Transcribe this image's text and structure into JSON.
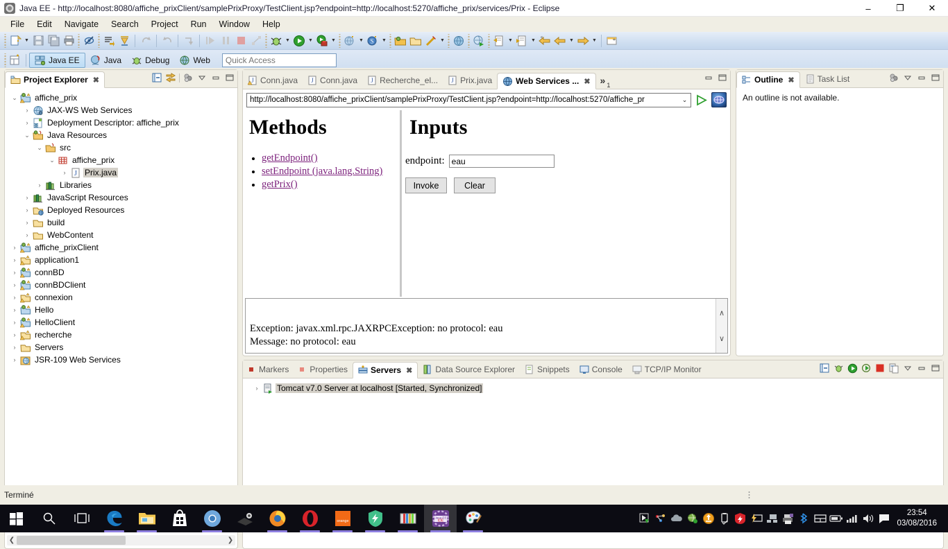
{
  "window": {
    "title": "Java EE - http://localhost:8080/affiche_prixClient/samplePrixProxy/TestClient.jsp?endpoint=http://localhost:5270/affiche_prix/services/Prix - Eclipse",
    "minimize": "–",
    "maximize": "❐",
    "close": "✕"
  },
  "menu": {
    "items": [
      "File",
      "Edit",
      "Navigate",
      "Search",
      "Project",
      "Run",
      "Window",
      "Help"
    ]
  },
  "perspectives": {
    "items": [
      {
        "label": "Java EE",
        "active": true
      },
      {
        "label": "Java",
        "active": false
      },
      {
        "label": "Debug",
        "active": false
      },
      {
        "label": "Web",
        "active": false
      }
    ]
  },
  "quick_access": {
    "placeholder": "Quick Access",
    "value": ""
  },
  "project_explorer": {
    "tab_label": "Project Explorer",
    "close_glyph": "✖",
    "tree": [
      {
        "depth": 0,
        "twist": "⌄",
        "icon": "project-warn",
        "label": "affiche_prix",
        "selected": false
      },
      {
        "depth": 1,
        "twist": "›",
        "icon": "jaxws",
        "label": "JAX-WS Web Services",
        "selected": false
      },
      {
        "depth": 1,
        "twist": "›",
        "icon": "deploy-desc",
        "label": "Deployment Descriptor: affiche_prix",
        "selected": false
      },
      {
        "depth": 1,
        "twist": "⌄",
        "icon": "java-res",
        "label": "Java Resources",
        "selected": false
      },
      {
        "depth": 2,
        "twist": "⌄",
        "icon": "src-folder",
        "label": "src",
        "selected": false
      },
      {
        "depth": 3,
        "twist": "⌄",
        "icon": "package",
        "label": "affiche_prix",
        "selected": false
      },
      {
        "depth": 4,
        "twist": "›",
        "icon": "java-file",
        "label": "Prix.java",
        "selected": true
      },
      {
        "depth": 2,
        "twist": "›",
        "icon": "libraries",
        "label": "Libraries",
        "selected": false
      },
      {
        "depth": 1,
        "twist": "›",
        "icon": "libraries",
        "label": "JavaScript Resources",
        "selected": false
      },
      {
        "depth": 1,
        "twist": "›",
        "icon": "deployed-res",
        "label": "Deployed Resources",
        "selected": false
      },
      {
        "depth": 1,
        "twist": "›",
        "icon": "folder",
        "label": "build",
        "selected": false
      },
      {
        "depth": 1,
        "twist": "›",
        "icon": "folder",
        "label": "WebContent",
        "selected": false
      },
      {
        "depth": 0,
        "twist": "›",
        "icon": "project-warn",
        "label": "affiche_prixClient",
        "selected": false
      },
      {
        "depth": 0,
        "twist": "›",
        "icon": "project-plain",
        "label": "application1",
        "selected": false
      },
      {
        "depth": 0,
        "twist": "›",
        "icon": "project-warn",
        "label": "connBD",
        "selected": false
      },
      {
        "depth": 0,
        "twist": "›",
        "icon": "project-warn",
        "label": "connBDClient",
        "selected": false
      },
      {
        "depth": 0,
        "twist": "›",
        "icon": "project-plain",
        "label": "connexion",
        "selected": false
      },
      {
        "depth": 0,
        "twist": "›",
        "icon": "project-plain2",
        "label": "Hello",
        "selected": false
      },
      {
        "depth": 0,
        "twist": "›",
        "icon": "project-warn",
        "label": "HelloClient",
        "selected": false
      },
      {
        "depth": 0,
        "twist": "›",
        "icon": "project-plain",
        "label": "recherche",
        "selected": false
      },
      {
        "depth": 0,
        "twist": "›",
        "icon": "folder",
        "label": "Servers",
        "selected": false
      },
      {
        "depth": 0,
        "twist": "›",
        "icon": "jsr109",
        "label": "JSR-109 Web Services",
        "selected": false
      }
    ]
  },
  "editor": {
    "tabs": [
      {
        "label": "Conn.java",
        "icon": "java-file-warn",
        "active": false
      },
      {
        "label": "Conn.java",
        "icon": "java-file",
        "active": false
      },
      {
        "label": "Recherche_el...",
        "icon": "java-file",
        "active": false
      },
      {
        "label": "Prix.java",
        "icon": "java-file",
        "active": false
      },
      {
        "label": "Web Services ...",
        "icon": "globe",
        "active": true
      }
    ],
    "overflow_label": "»",
    "overflow_count": "1",
    "close_glyph": "✖",
    "minimize_glyph": "–",
    "maximize_glyph": "❐",
    "url": "http://localhost:8080/affiche_prixClient/samplePrixProxy/TestClient.jsp?endpoint=http://localhost:5270/affiche_pr",
    "url_caret": "⌄"
  },
  "browser": {
    "methods_heading": "Methods",
    "methods": [
      "getEndpoint()",
      "setEndpoint (java.lang.String)",
      "getPrix()"
    ],
    "inputs_heading": "Inputs",
    "endpoint_label": "endpoint:",
    "endpoint_value": "eau",
    "invoke_label": "Invoke",
    "clear_label": "Clear",
    "result_text": "Exception: javax.xml.rpc.JAXRPCException: no protocol: eau\nMessage: no protocol: eau",
    "scroll_up": "∧",
    "scroll_down": "∨",
    "link_color": "#7b1f7b"
  },
  "outline": {
    "tabs": [
      {
        "label": "Outline",
        "active": true,
        "icon": "outline-icon"
      },
      {
        "label": "Task List",
        "active": false,
        "icon": "tasklist-icon"
      }
    ],
    "close_glyph": "✖",
    "body_text": "An outline is not available."
  },
  "bottom": {
    "tabs": [
      {
        "label": "Markers",
        "active": false,
        "icon": "marker-icon"
      },
      {
        "label": "Properties",
        "active": false,
        "icon": "properties-icon"
      },
      {
        "label": "Servers",
        "active": true,
        "icon": "servers-icon"
      },
      {
        "label": "Data Source Explorer",
        "active": false,
        "icon": "datasource-icon"
      },
      {
        "label": "Snippets",
        "active": false,
        "icon": "snippets-icon"
      },
      {
        "label": "Console",
        "active": false,
        "icon": "console-icon"
      },
      {
        "label": "TCP/IP Monitor",
        "active": false,
        "icon": "tcpip-icon"
      }
    ],
    "close_glyph": "✖",
    "server_row": {
      "twist": "›",
      "label": "Tomcat v7.0 Server at localhost  [Started, Synchronized]"
    }
  },
  "status": {
    "text": "Terminé"
  },
  "taskbar": {
    "clock_time": "23:54",
    "clock_date": "03/08/2016"
  }
}
